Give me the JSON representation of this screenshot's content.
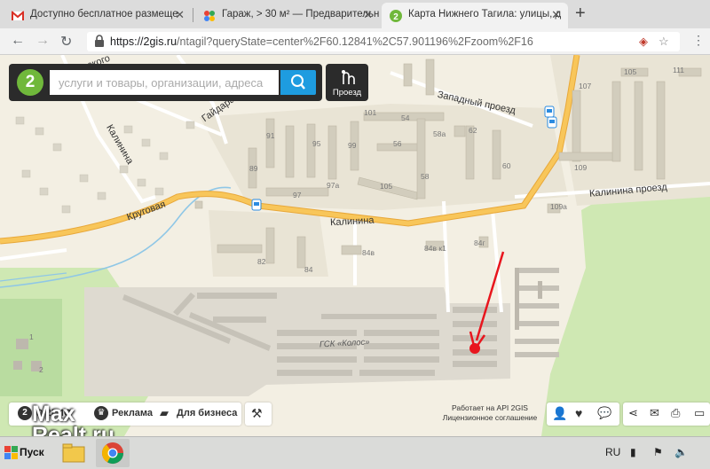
{
  "browser": {
    "tabs": [
      {
        "title": "Доступно бесплатное размеще",
        "active": false
      },
      {
        "title": "Гараж, > 30 м² — Предварительн",
        "active": false
      },
      {
        "title": "Карта Нижнего Тагила: улицы, д",
        "active": true
      }
    ],
    "new_tab": "+",
    "url_host": "https://2gis.ru",
    "url_path": "/ntagil?queryState=center%2F60.12841%2C57.901196%2Fzoom%2F16"
  },
  "search": {
    "logo": "2",
    "placeholder": "услуги и товары, организации, адреса",
    "route_label": "Проезд"
  },
  "map": {
    "streets": {
      "gaidara": "Гайдара",
      "kalinina_left": "Калинина",
      "krugovaya": "Круговая",
      "kalinina_main": "Калинина",
      "zapadny": "Западный проезд",
      "kalinina_proezd": "Калинина проезд",
      "partial_top": "ского"
    },
    "gsk_label": "ГСК «Колос»",
    "building_numbers": {
      "b91": "91",
      "b95": "95",
      "b99": "99",
      "b101": "101",
      "b89": "89",
      "b97": "97",
      "b97a": "97а",
      "b54": "54",
      "b56": "56",
      "b58a": "58а",
      "b58": "58",
      "b62": "62",
      "b60": "60",
      "b105": "105",
      "b82": "82",
      "b84": "84",
      "b84v": "84в",
      "b84k1": "84в к1",
      "b84g": "84г",
      "b107": "107",
      "b105r": "105",
      "b111": "111",
      "b109": "109",
      "b109a": "109а",
      "b1": "1",
      "b2": "2"
    },
    "pin_color": "#e8161e"
  },
  "bottom": {
    "about": "О 2ГИС",
    "ads": "Реклама",
    "business": "Для бизнеса",
    "api_line1": "Работает на API 2GIS",
    "api_line2": "Лицензионное соглашение"
  },
  "watermark": {
    "line1": "Max",
    "line2": "Realt.ru"
  },
  "taskbar": {
    "start": "Пуск",
    "lang": "RU"
  }
}
